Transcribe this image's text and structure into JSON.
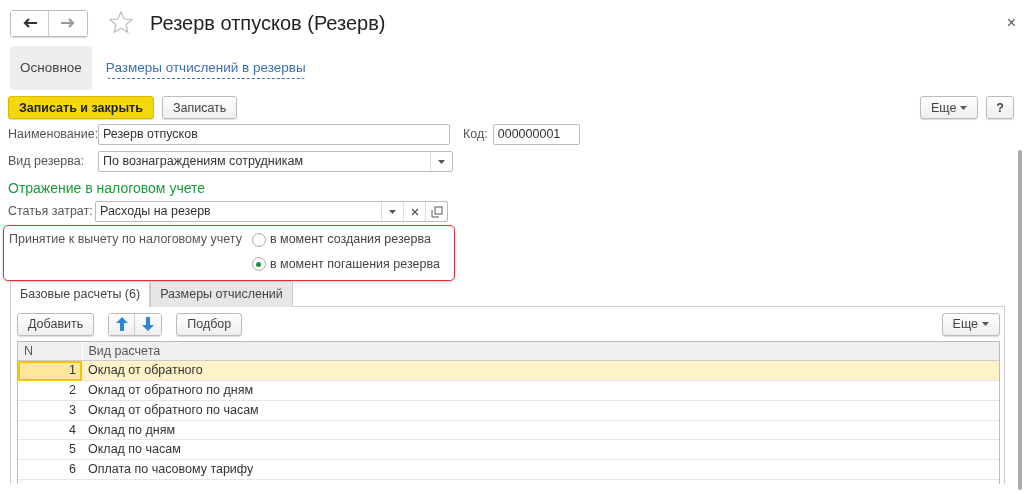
{
  "window": {
    "title": "Резерв отпусков (Резерв)",
    "close": "×"
  },
  "sections": [
    {
      "label": "Основное",
      "selected": true
    },
    {
      "label": "Размеры отчислений в резервы",
      "selected": false
    }
  ],
  "toolbar": {
    "buttons": [
      {
        "label": "Записать и закрыть",
        "kind": "primary"
      },
      {
        "label": "Записать",
        "kind": "default"
      }
    ],
    "more": "Еще",
    "help": "?"
  },
  "name_field": {
    "label": "Наименование:",
    "value": "Резерв отпусков"
  },
  "code_field": {
    "label": "Код:",
    "value": "000000001"
  },
  "reserve_type": {
    "label": "Вид резерва:",
    "value": "По вознаграждениям сотрудникам"
  },
  "tax_heading": "Отражение в налоговом учете",
  "expense_item": {
    "label": "Статья затрат:",
    "value": "Расходы на резерв"
  },
  "deduction": {
    "label": "Принятие к вычету по налоговому учету",
    "options": [
      {
        "label": "в момент создания резерва",
        "selected": false
      },
      {
        "label": "в момент погашения резерва",
        "selected": true
      }
    ]
  },
  "tabs": [
    {
      "label": "Базовые расчеты (6)",
      "selected": true
    },
    {
      "label": "Размеры отчислений",
      "selected": false
    }
  ],
  "table_toolbar": {
    "add": "Добавить",
    "pick": "Подбор",
    "more": "Еще"
  },
  "table": {
    "columns": [
      "N",
      "Вид расчета"
    ],
    "rows": [
      {
        "n": "1",
        "name": "Оклад от обратного",
        "selected": true
      },
      {
        "n": "2",
        "name": "Оклад от обратного по дням",
        "selected": false
      },
      {
        "n": "3",
        "name": "Оклад от обратного по часам",
        "selected": false
      },
      {
        "n": "4",
        "name": "Оклад по дням",
        "selected": false
      },
      {
        "n": "5",
        "name": "Оклад по часам",
        "selected": false
      },
      {
        "n": "6",
        "name": "Оплата по часовому тарифу",
        "selected": false
      }
    ]
  }
}
